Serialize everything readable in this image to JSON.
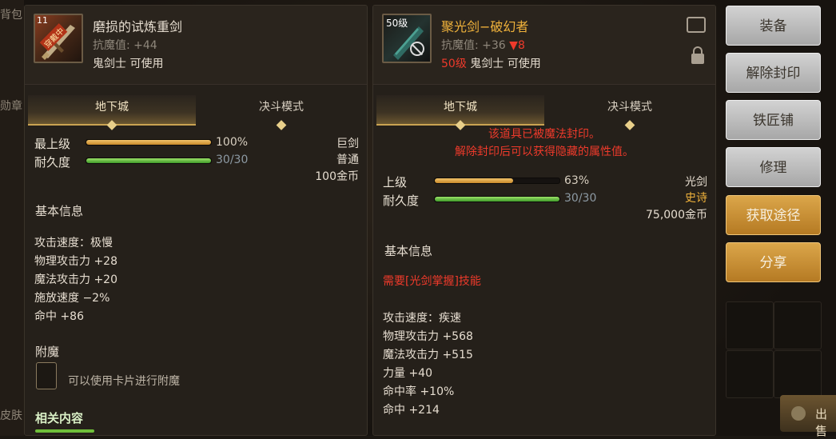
{
  "background": {
    "left_labels": [
      "背包",
      "勋章",
      "皮肤"
    ],
    "sell_button_label": "出售"
  },
  "left_item": {
    "name": "磨损的试炼重剑",
    "icon_badge": "穿戴中",
    "icon_level": "11",
    "resist_label": "抗魔值:",
    "resist_value": "+44",
    "usable_by": "鬼剑士 可使用",
    "tabs": [
      "地下城",
      "决斗模式"
    ],
    "upgrade_label": "最上级",
    "upgrade_percent": 100,
    "upgrade_text": "100%",
    "durability_label": "耐久度",
    "durability_fraction": 1.0,
    "durability_text": "30/30",
    "weapon_type": "巨剑",
    "rarity": "普通",
    "price": "100金币",
    "basic_info_title": "基本信息",
    "basic_stats": [
      "攻击速度：极慢",
      "物理攻击力 +28",
      "魔法攻击力 +20",
      "施放速度 −2%",
      "命中 +86"
    ],
    "enchant_title": "附魔",
    "enchant_hint": "可以使用卡片进行附魔",
    "related_title": "相关内容"
  },
  "right_item": {
    "level_badge": "50级",
    "name": "聚光剑−破幻者",
    "resist_label": "抗魔值:",
    "resist_value": "+36",
    "resist_diff": "▼8",
    "req_level": "50级",
    "usable_by": "鬼剑士 可使用",
    "tabs": [
      "地下城",
      "决斗模式"
    ],
    "sealed_line1": "该道具已被魔法封印。",
    "sealed_line2": "解除封印后可以获得隐藏的属性值。",
    "upgrade_label": "上级",
    "upgrade_percent": 63,
    "upgrade_text": "63%",
    "durability_label": "耐久度",
    "durability_fraction": 1.0,
    "durability_text": "30/30",
    "weapon_type": "光剑",
    "rarity": "史诗",
    "price": "75,000金币",
    "basic_info_title": "基本信息",
    "skill_required": "需要[光剑掌握]技能",
    "basic_stats": [
      "攻击速度：疾速",
      "物理攻击力 +568",
      "魔法攻击力 +515",
      "力量 +40",
      "命中率 +10%",
      "命中 +214"
    ]
  },
  "side_buttons": [
    "装备",
    "解除封印",
    "铁匠铺",
    "修理",
    "获取途径",
    "分享"
  ],
  "colors": {
    "panel_bg": "#25201a",
    "gold_accent": "#c9a352",
    "epic": "#f0b23b",
    "sealed_red": "#ee3a2b",
    "button_gray": "#bcbcbc",
    "button_gold": "#c98f35"
  }
}
